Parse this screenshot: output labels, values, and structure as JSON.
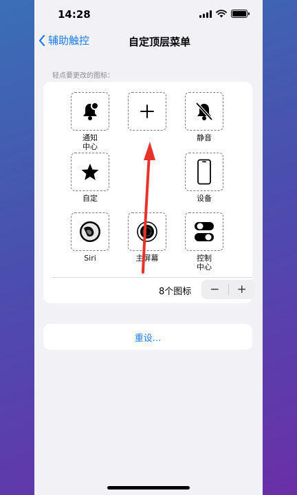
{
  "status_bar": {
    "time": "14:28"
  },
  "nav": {
    "back_label": "辅助触控",
    "title": "自定顶层菜单"
  },
  "section_hint": "轻点要更改的图标：",
  "icons": [
    {
      "label": "通知\n中心",
      "icon": "notification-bell-icon"
    },
    {
      "label": "",
      "icon": "plus-icon"
    },
    {
      "label": "静音",
      "icon": "mute-bell-icon"
    },
    {
      "label": "自定",
      "icon": "star-icon"
    },
    {
      "label": "设备",
      "icon": "iphone-icon"
    },
    {
      "label": "Siri",
      "icon": "siri-icon"
    },
    {
      "label": "主屏幕",
      "icon": "home-button-icon"
    },
    {
      "label": "控制\n中心",
      "icon": "toggle-switches-icon"
    }
  ],
  "labels": {
    "notification_l1": "通知",
    "notification_l2": "中心",
    "mute": "静音",
    "custom": "自定",
    "device": "设备",
    "siri": "Siri",
    "home": "主屏幕",
    "control_l1": "控制",
    "control_l2": "中心"
  },
  "count": {
    "label": "8个图标",
    "minus": "−",
    "plus": "+"
  },
  "reset": {
    "label": "重设..."
  },
  "colors": {
    "accent": "#1a7cf5",
    "arrow": "#e8322a"
  }
}
